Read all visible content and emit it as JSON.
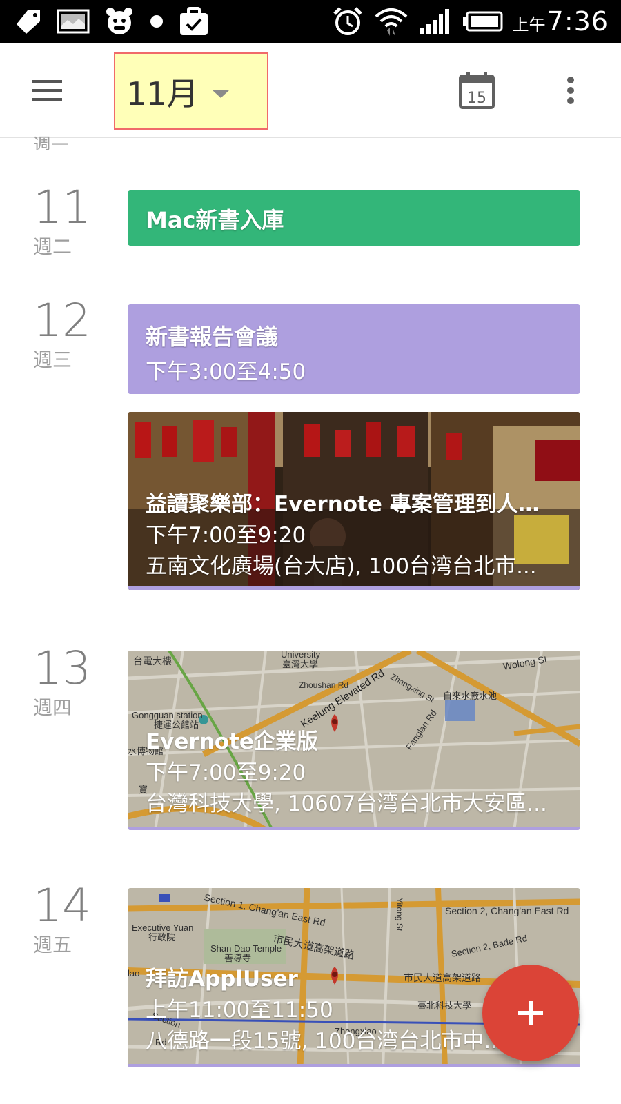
{
  "status_bar": {
    "ampm": "上午",
    "time": "7:36",
    "icons_left": [
      "tag-icon",
      "image-icon",
      "mascot-icon",
      "dot-icon",
      "briefcase-check-icon"
    ],
    "icons_right": [
      "alarm-icon",
      "wifi-icon",
      "signal-icon",
      "battery-icon"
    ]
  },
  "app_bar": {
    "month": "11月",
    "today_icon_day": "15",
    "icons": [
      "menu-icon",
      "dropdown-caret-icon",
      "today-calendar-icon",
      "more-vert-icon"
    ]
  },
  "partial_day": {
    "dow": "週一"
  },
  "days": [
    {
      "num": "11",
      "dow": "週二",
      "events": [
        {
          "title": "Mac新書入庫",
          "color": "#33b679"
        }
      ]
    },
    {
      "num": "12",
      "dow": "週三",
      "events": [
        {
          "title": "新書報告會議",
          "time": "下午3:00至4:50",
          "color": "#ae9fdf"
        },
        {
          "title": "益讀聚樂部：Evernote 專案管理到人生...",
          "time": "下午7:00至9:20",
          "location": "五南文化廣場(台大店), 100台湾台北市...",
          "background": "photo"
        }
      ]
    },
    {
      "num": "13",
      "dow": "週四",
      "events": [
        {
          "title": "Evernote企業版",
          "time": "下午7:00至9:20",
          "location": "台灣科技大學, 10607台湾台北市大安區...",
          "background": "map"
        }
      ]
    },
    {
      "num": "14",
      "dow": "週五",
      "events": [
        {
          "title": "拜訪ApplUser",
          "time": "上午11:00至11:50",
          "location": "八德路一段15號, 100台湾台北市中...",
          "background": "map"
        }
      ]
    }
  ],
  "map_labels": {
    "map1": [
      "台電大樓",
      "University",
      "臺灣大學",
      "Zhoushan Rd",
      "Keelung Elevated Rd",
      "Zhangxing St",
      "Wolong St",
      "自來水廠水池",
      "Gongguan station",
      "捷運公館站",
      "Fanglan Rd",
      "水博物館",
      "寶"
    ],
    "map2": [
      "Section 1, Chang'an East Rd",
      "Section 2, Chang'an East Rd",
      "Executive Yuan",
      "行政院",
      "Shan Dao Temple",
      "善導寺",
      "市民大道高架道路",
      "Section 2, Bade Rd",
      "臺北科技大學",
      "Zhongxiao",
      "Yitong St",
      "lao",
      "Section",
      "Rd"
    ]
  },
  "fab": {
    "label": "+",
    "color": "#db4437"
  }
}
